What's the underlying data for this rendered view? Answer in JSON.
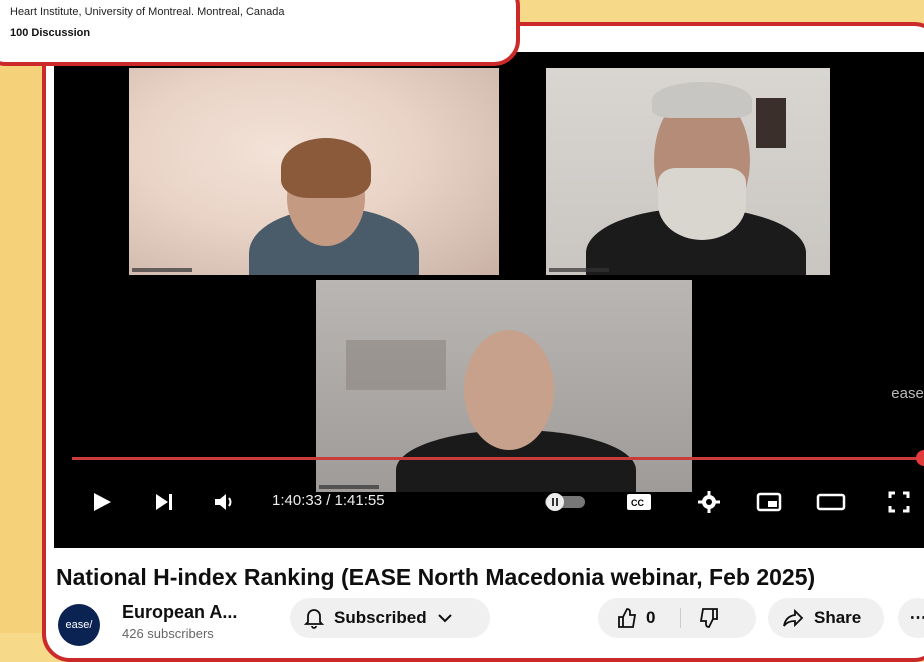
{
  "overlay": {
    "affiliation": "Heart Institute, University of Montreal. Montreal, Canada",
    "discussion": "100 Discussion"
  },
  "player": {
    "time": "1:40:33 / 1:41:55",
    "watermark": "ease/",
    "progress_fraction": 0.99
  },
  "video": {
    "title": "National H-index Ranking (EASE North Macedonia webinar, Feb 2025)"
  },
  "channel": {
    "avatar_text": "ease/",
    "name": "European A...",
    "subscribers": "426 subscribers"
  },
  "actions": {
    "subscribed_label": "Subscribed",
    "like_count": "0",
    "share_label": "Share"
  },
  "colors": {
    "frame_border": "#cc2a2a",
    "page_bg": "#f7d98a",
    "progress": "#cc3b3b"
  }
}
